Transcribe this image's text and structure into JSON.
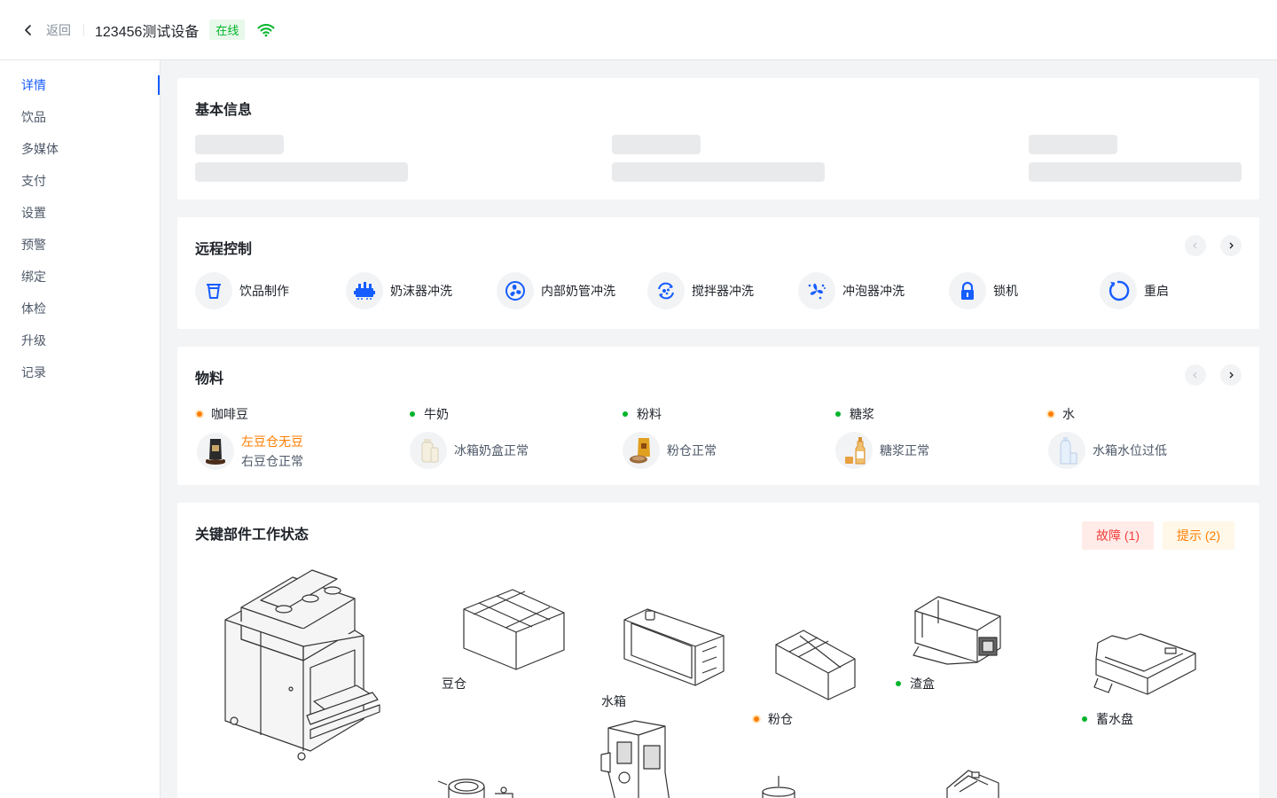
{
  "header": {
    "back_label": "返回",
    "device_name": "123456测试设备",
    "status": "在线"
  },
  "sidebar": {
    "items": [
      {
        "label": "详情",
        "active": true
      },
      {
        "label": "饮品"
      },
      {
        "label": "多媒体"
      },
      {
        "label": "支付"
      },
      {
        "label": "设置"
      },
      {
        "label": "预警"
      },
      {
        "label": "绑定"
      },
      {
        "label": "体检"
      },
      {
        "label": "升级"
      },
      {
        "label": "记录"
      }
    ]
  },
  "basic_info": {
    "title": "基本信息"
  },
  "remote_control": {
    "title": "远程控制",
    "items": [
      {
        "label": "饮品制作",
        "icon": "cup-icon"
      },
      {
        "label": "奶沫器冲洗",
        "icon": "milk-frother-icon"
      },
      {
        "label": "内部奶管冲洗",
        "icon": "fan-icon"
      },
      {
        "label": "搅拌器冲洗",
        "icon": "mixer-rinse-icon"
      },
      {
        "label": "冲泡器冲洗",
        "icon": "brewer-rinse-icon"
      },
      {
        "label": "锁机",
        "icon": "lock-icon"
      },
      {
        "label": "重启",
        "icon": "restart-icon"
      }
    ]
  },
  "materials": {
    "title": "物料",
    "items": [
      {
        "name": "咖啡豆",
        "status_color": "orange",
        "lines": [
          "左豆仓无豆",
          "右豆仓正常"
        ],
        "warn_line": 0
      },
      {
        "name": "牛奶",
        "status_color": "green",
        "lines": [
          "冰箱奶盒正常"
        ]
      },
      {
        "name": "粉料",
        "status_color": "green",
        "lines": [
          "粉仓正常"
        ]
      },
      {
        "name": "糖浆",
        "status_color": "green",
        "lines": [
          "糖浆正常"
        ]
      },
      {
        "name": "水",
        "status_color": "orange",
        "lines": [
          "水箱水位过低"
        ]
      }
    ]
  },
  "components": {
    "title": "关键部件工作状态",
    "fault_label": "故障 (1)",
    "tip_label": "提示 (2)",
    "parts": [
      {
        "label": "豆仓",
        "status_color": ""
      },
      {
        "label": "水箱",
        "status_color": ""
      },
      {
        "label": "粉仓",
        "status_color": "orange"
      },
      {
        "label": "渣盒",
        "status_color": "green"
      },
      {
        "label": "蓄水盘",
        "status_color": "green"
      }
    ]
  },
  "colors": {
    "primary": "#165dff",
    "online": "#00b42a",
    "warning": "#ff7d00",
    "danger": "#f53f3f"
  }
}
